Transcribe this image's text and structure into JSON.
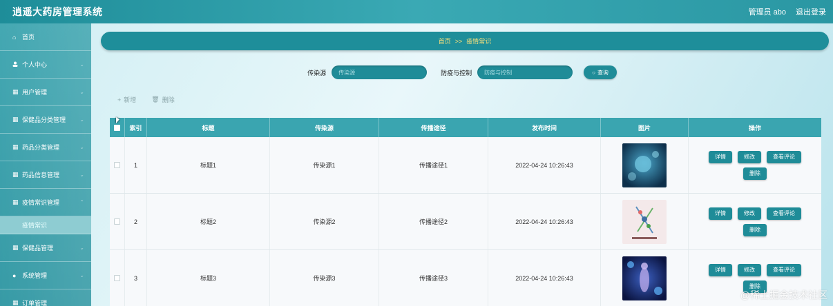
{
  "header": {
    "title": "逍遥大药房管理系统",
    "user": "管理员 abo",
    "logout": "退出登录"
  },
  "sidebar": {
    "items": [
      {
        "label": "首页",
        "icon": "home-icon",
        "glyph": "⌂"
      },
      {
        "label": "个人中心",
        "icon": "user-icon",
        "glyph": "👤"
      },
      {
        "label": "用户管理",
        "icon": "grid-icon",
        "glyph": "▦"
      },
      {
        "label": "保健品分类管理",
        "icon": "grid-icon",
        "glyph": "▦"
      },
      {
        "label": "药品分类管理",
        "icon": "grid-icon",
        "glyph": "▦"
      },
      {
        "label": "药品信息管理",
        "icon": "grid-icon",
        "glyph": "▦"
      },
      {
        "label": "疫情常识管理",
        "icon": "grid-icon",
        "glyph": "▦"
      },
      {
        "label": "保健品管理",
        "icon": "grid-icon",
        "glyph": "▦"
      },
      {
        "label": "系统管理",
        "icon": "location-icon",
        "glyph": "●"
      },
      {
        "label": "订单管理",
        "icon": "grid-icon",
        "glyph": "▦"
      }
    ],
    "active_sub": "疫情常识"
  },
  "breadcrumb": {
    "home": "首页",
    "separator": ">>",
    "current": "疫情常识"
  },
  "search": {
    "label1": "传染源",
    "placeholder1": "传染源",
    "label2": "防疫与控制",
    "placeholder2": "防疫与控制",
    "button": "查询"
  },
  "actions": {
    "add": "新增",
    "delete": "删除"
  },
  "table": {
    "headers": [
      "索引",
      "标题",
      "传染源",
      "传播途径",
      "发布时间",
      "图片",
      "操作"
    ],
    "rows": [
      {
        "index": "1",
        "title": "标题1",
        "source": "传染源1",
        "route": "传播途径1",
        "time": "2022-04-24 10:26:43"
      },
      {
        "index": "2",
        "title": "标题2",
        "source": "传染源2",
        "route": "传播途径2",
        "time": "2022-04-24 10:26:43"
      },
      {
        "index": "3",
        "title": "标题3",
        "source": "传染源3",
        "route": "传播途径3",
        "time": "2022-04-24 10:26:43"
      }
    ],
    "ops": {
      "detail": "详情",
      "edit": "修改",
      "comments": "查看评论",
      "delete": "删除"
    }
  },
  "watermark": "@稀土掘金技术社区",
  "colors": {
    "accent": "#1f8c98",
    "header_bg": "#3aa5b0",
    "breadcrumb_text": "#ffe27a"
  }
}
